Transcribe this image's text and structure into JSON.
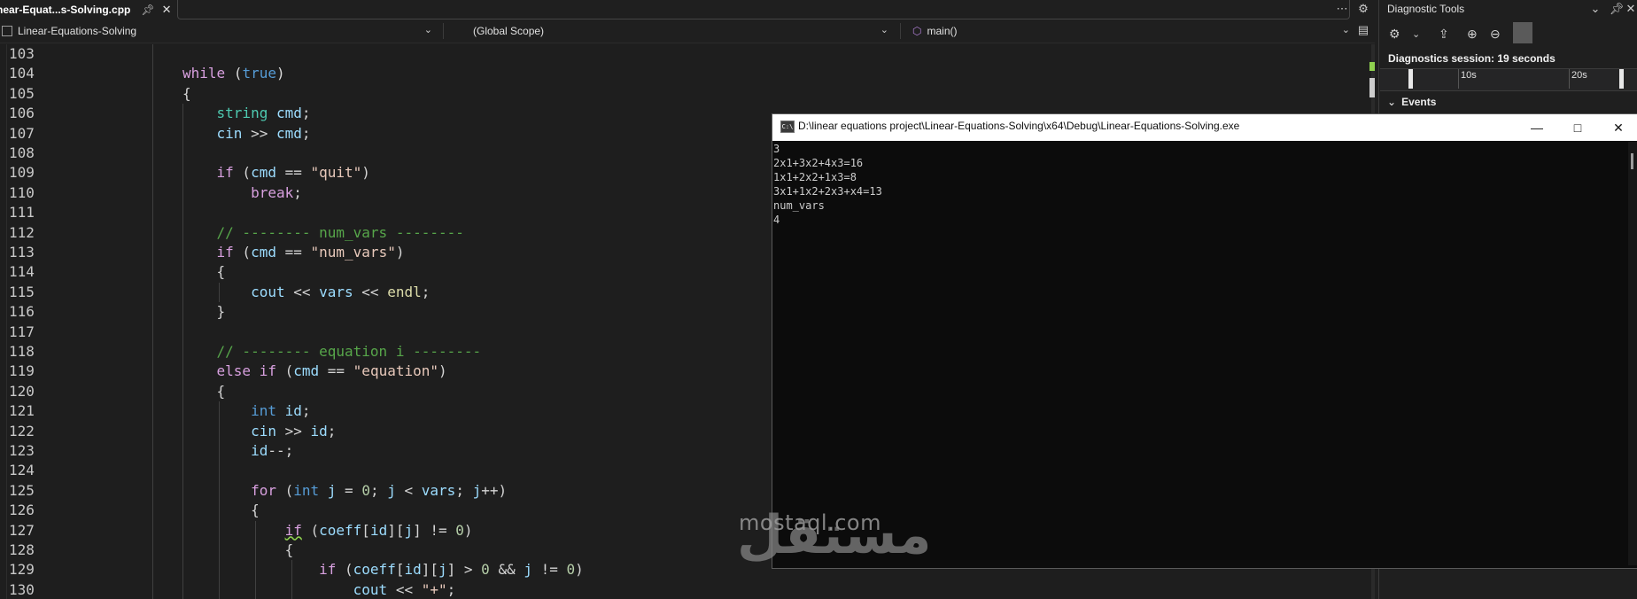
{
  "tab": {
    "title": "near-Equat...s-Solving.cpp"
  },
  "navbar": {
    "project": "Linear-Equations-Solving",
    "scope": "(Global Scope)",
    "member": "main()"
  },
  "diagnostic": {
    "title": "Diagnostic Tools",
    "session": "Diagnostics session: 19 seconds",
    "tick_10s": "10s",
    "tick_20s": "20s",
    "events": "Events"
  },
  "console": {
    "title": "D:\\linear equations project\\Linear-Equations-Solving\\x64\\Debug\\Linear-Equations-Solving.exe",
    "icon_text": "C:\\",
    "output": "3\n2x1+3x2+4x3=16\n1x1+2x2+1x3=8\n3x1+1x2+2x3+x4=13\nnum_vars\n4"
  },
  "watermark": {
    "latin": "mostaql.com",
    "arabic": "مستقل"
  },
  "code_lines": [
    {
      "n": "103"
    },
    {
      "n": "104"
    },
    {
      "n": "105"
    },
    {
      "n": "106"
    },
    {
      "n": "107"
    },
    {
      "n": "108"
    },
    {
      "n": "109"
    },
    {
      "n": "110"
    },
    {
      "n": "111"
    },
    {
      "n": "112"
    },
    {
      "n": "113"
    },
    {
      "n": "114"
    },
    {
      "n": "115"
    },
    {
      "n": "116"
    },
    {
      "n": "117"
    },
    {
      "n": "118"
    },
    {
      "n": "119"
    },
    {
      "n": "120"
    },
    {
      "n": "121"
    },
    {
      "n": "122"
    },
    {
      "n": "123"
    },
    {
      "n": "124"
    },
    {
      "n": "125"
    },
    {
      "n": "126"
    },
    {
      "n": "127"
    },
    {
      "n": "128"
    },
    {
      "n": "129"
    },
    {
      "n": "130"
    }
  ]
}
